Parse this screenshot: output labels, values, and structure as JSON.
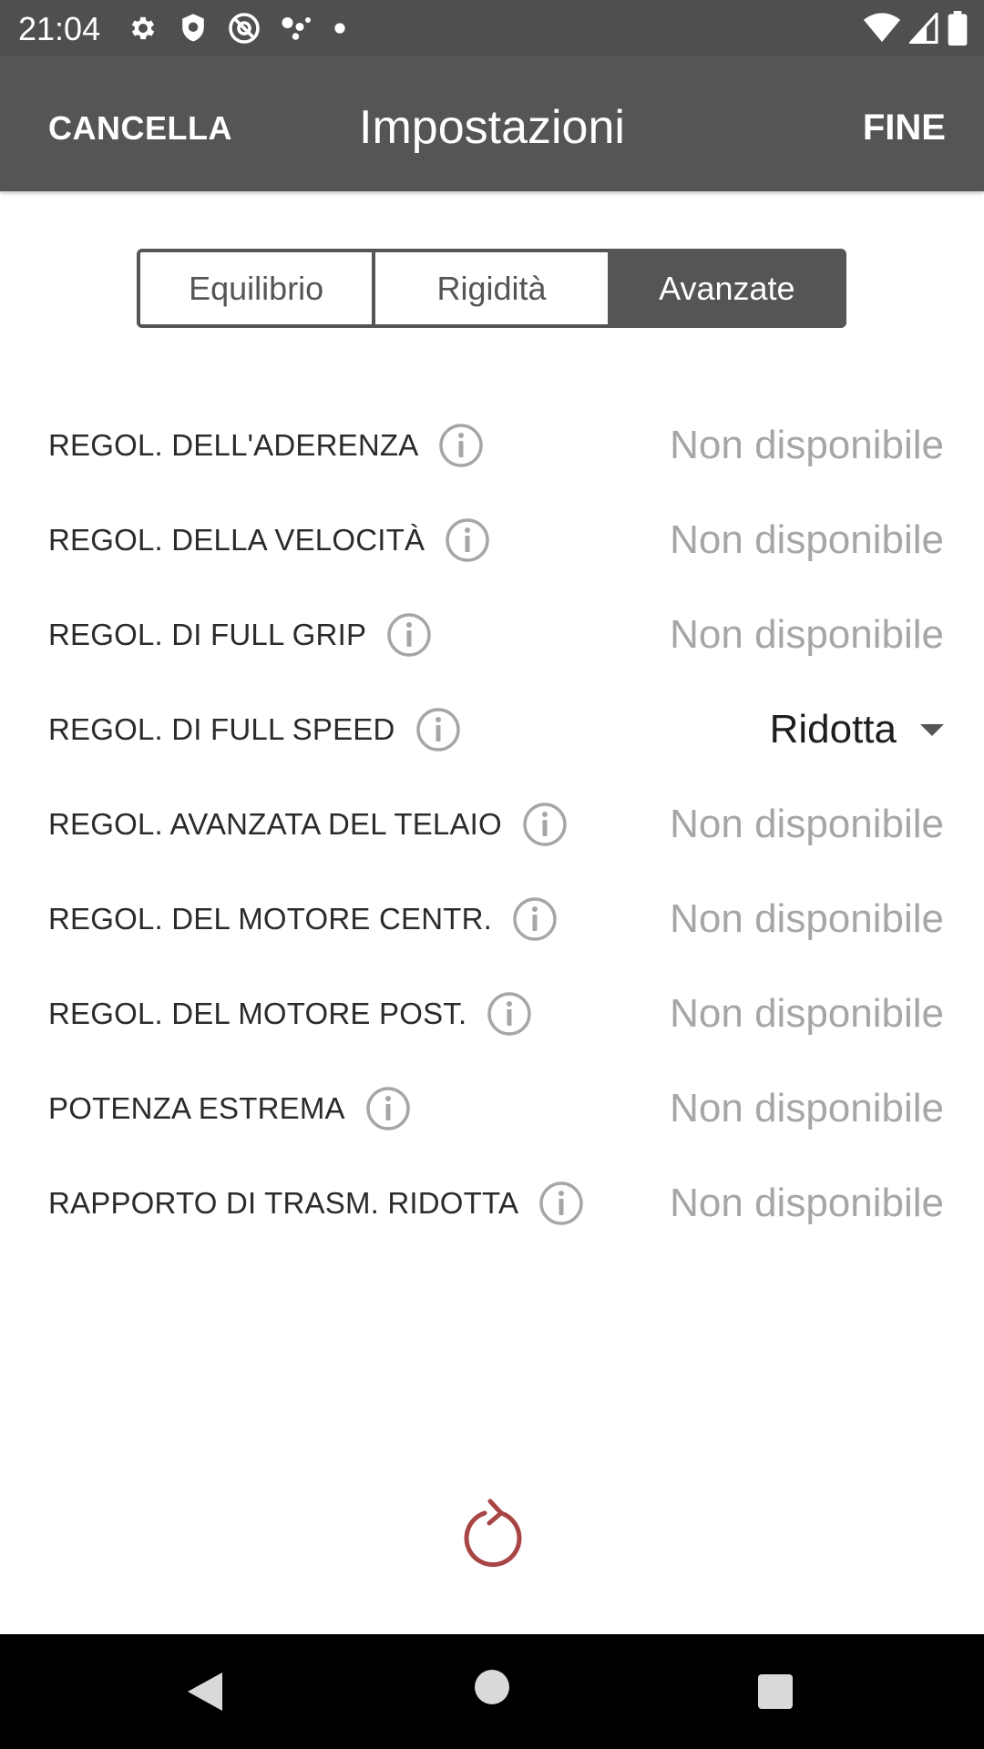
{
  "status_bar": {
    "time": "21:04",
    "left_icons": [
      "settings-icon",
      "shield-icon",
      "at-sign-icon",
      "dots-cluster-icon",
      "dot-icon"
    ],
    "right_icons": [
      "wifi-icon",
      "cell-signal-icon",
      "battery-icon"
    ]
  },
  "app_bar": {
    "cancel_label": "CANCELLA",
    "title": "Impostazioni",
    "done_label": "FINE"
  },
  "tabs": [
    {
      "label": "Equilibrio",
      "active": false
    },
    {
      "label": "Rigidità",
      "active": false
    },
    {
      "label": "Avanzate",
      "active": true
    }
  ],
  "settings": [
    {
      "label": "REGOL. DELL'ADERENZA",
      "value": "Non disponibile",
      "dropdown": false
    },
    {
      "label": "REGOL. DELLA VELOCITÀ",
      "value": "Non disponibile",
      "dropdown": false
    },
    {
      "label": "REGOL. DI FULL GRIP",
      "value": "Non disponibile",
      "dropdown": false
    },
    {
      "label": "REGOL. DI FULL SPEED",
      "value": "Ridotta",
      "dropdown": true
    },
    {
      "label": "REGOL. AVANZATA DEL TELAIO",
      "value": "Non disponibile",
      "dropdown": false
    },
    {
      "label": "REGOL. DEL MOTORE CENTR.",
      "value": "Non disponibile",
      "dropdown": false
    },
    {
      "label": "REGOL. DEL MOTORE POST.",
      "value": "Non disponibile",
      "dropdown": false
    },
    {
      "label": "POTENZA ESTREMA",
      "value": "Non disponibile",
      "dropdown": false
    },
    {
      "label": "RAPPORTO DI TRASM. RIDOTTA",
      "value": "Non disponibile",
      "dropdown": false
    }
  ],
  "icons": {
    "info": "info-icon",
    "reload": "reload-icon",
    "dropdown": "caret-down-icon"
  },
  "colors": {
    "app_bar": "#555555",
    "status_bar": "#4f4f4f",
    "reload_accent": "#a84545",
    "unavailable_text": "#a6a6a6"
  },
  "nav_bar": {
    "buttons": [
      "back-icon",
      "home-icon",
      "recents-icon"
    ]
  }
}
